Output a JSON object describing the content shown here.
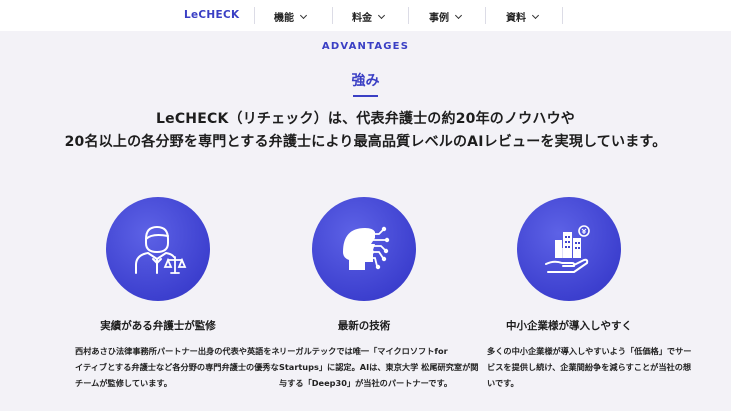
{
  "nav": {
    "brand": "LeCHECK",
    "items": [
      {
        "label": "機能"
      },
      {
        "label": "料金"
      },
      {
        "label": "事例"
      },
      {
        "label": "資料"
      }
    ]
  },
  "section": {
    "eyebrow": "ADVANTAGES",
    "title": "強み",
    "lead_line1": "LeCHECK（リチェック）は、代表弁護士の約20年のノウハウや",
    "lead_line2": "20名以上の各分野を専門とする弁護士により最高品質レベルのAIレビューを実現しています。"
  },
  "features": [
    {
      "icon": "lawyer-icon",
      "title": "実績がある弁護士が監修",
      "desc": "西村あさひ法律事務所パートナー出身の代表や英語をネイティブとする弁護士など各分野の専門弁護士の優秀なチームが監修しています。"
    },
    {
      "icon": "ai-brain-icon",
      "title": "最新の技術",
      "desc": "リーガルテックでは唯一「マイクロソフトfor Startups」に認定。AIは、東京大学 松尾研究室が関与する「Deep30」が当社のパートナーです。"
    },
    {
      "icon": "city-hand-icon",
      "title": "中小企業様が導入しやすく",
      "desc": "多くの中小企業様が導入しやすいよう「低価格」でサービスを提供し続け、企業間紛争を減らすことが当社の想いです。"
    }
  ],
  "colors": {
    "accent": "#3a3fc4",
    "background": "#f3f2f7"
  }
}
